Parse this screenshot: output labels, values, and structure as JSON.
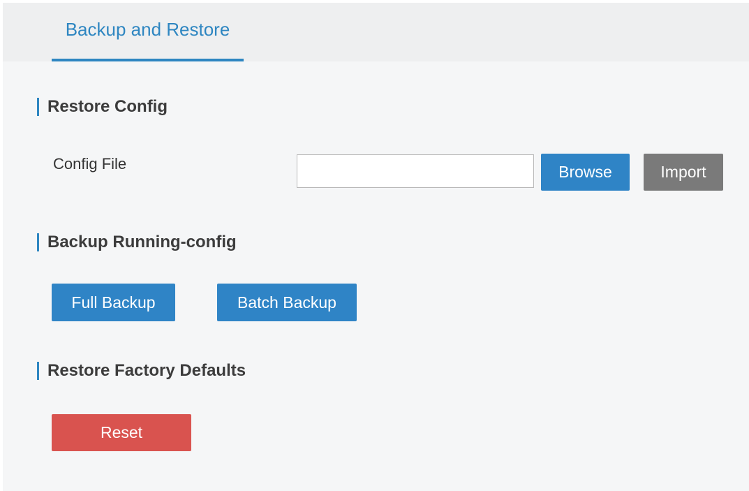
{
  "tabs": [
    {
      "label": "Backup and Restore",
      "active": true
    }
  ],
  "restore_config": {
    "title": "Restore Config",
    "config_file_label": "Config File",
    "config_file_value": "",
    "browse_label": "Browse",
    "import_label": "Import"
  },
  "backup": {
    "title": "Backup Running-config",
    "full_backup_label": "Full Backup",
    "batch_backup_label": "Batch Backup"
  },
  "factory": {
    "title": "Restore Factory Defaults",
    "reset_label": "Reset"
  },
  "colors": {
    "accent": "#2e86c1",
    "button_blue": "#2f84c6",
    "button_gray": "#7a7a7a",
    "button_red": "#d9534f",
    "background": "#f5f6f7"
  }
}
